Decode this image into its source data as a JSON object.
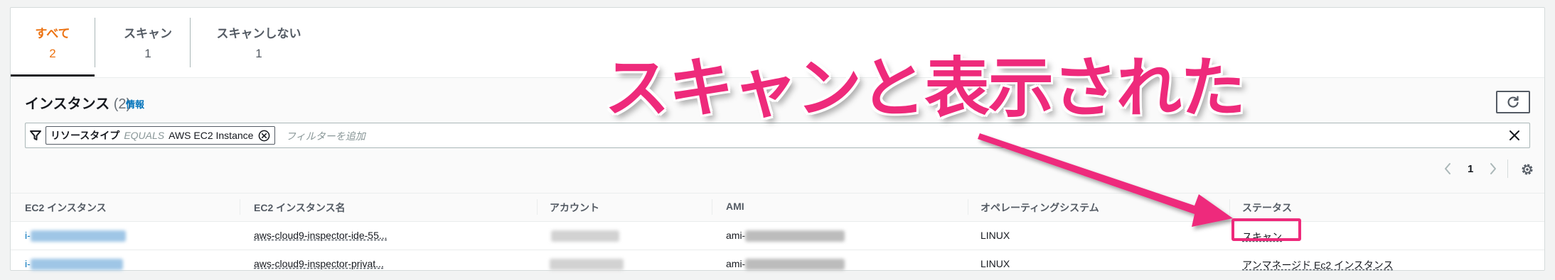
{
  "tabs": [
    {
      "label": "すべて",
      "count": "2",
      "active": true
    },
    {
      "label": "スキャン",
      "count": "1",
      "active": false
    },
    {
      "label": "スキャンしない",
      "count": "1",
      "active": false
    }
  ],
  "section": {
    "title": "インスタンス",
    "count": "(2)",
    "info": "情報"
  },
  "filter": {
    "token_key": "リソースタイプ",
    "token_op": "EQUALS",
    "token_value": "AWS EC2 Instance",
    "placeholder": "フィルターを追加"
  },
  "pagination": {
    "current_page": "1"
  },
  "table": {
    "columns": [
      "EC2 インスタンス",
      "EC2 インスタンス名",
      "アカウント",
      "AMI",
      "オペレーティングシステム",
      "ステータス"
    ],
    "rows": [
      {
        "instance_prefix": "i-",
        "name": "aws-cloud9-inspector-ide-55...",
        "ami_prefix": "ami-",
        "os": "LINUX",
        "status": "スキャン"
      },
      {
        "instance_prefix": "i-",
        "name": "aws-cloud9-inspector-privat...",
        "ami_prefix": "ami-",
        "os": "LINUX",
        "status": "アンマネージド Ec2 インスタンス"
      }
    ]
  },
  "annotation": {
    "text": "スキャンと表示された",
    "color": "#ee2a7b"
  },
  "colors": {
    "accent_tab": "#ec7211",
    "link": "#0073bb"
  },
  "icons": [
    "filter-icon",
    "dismiss-icon",
    "close-icon",
    "refresh-icon",
    "chevron-left-icon",
    "chevron-right-icon",
    "gear-icon"
  ]
}
